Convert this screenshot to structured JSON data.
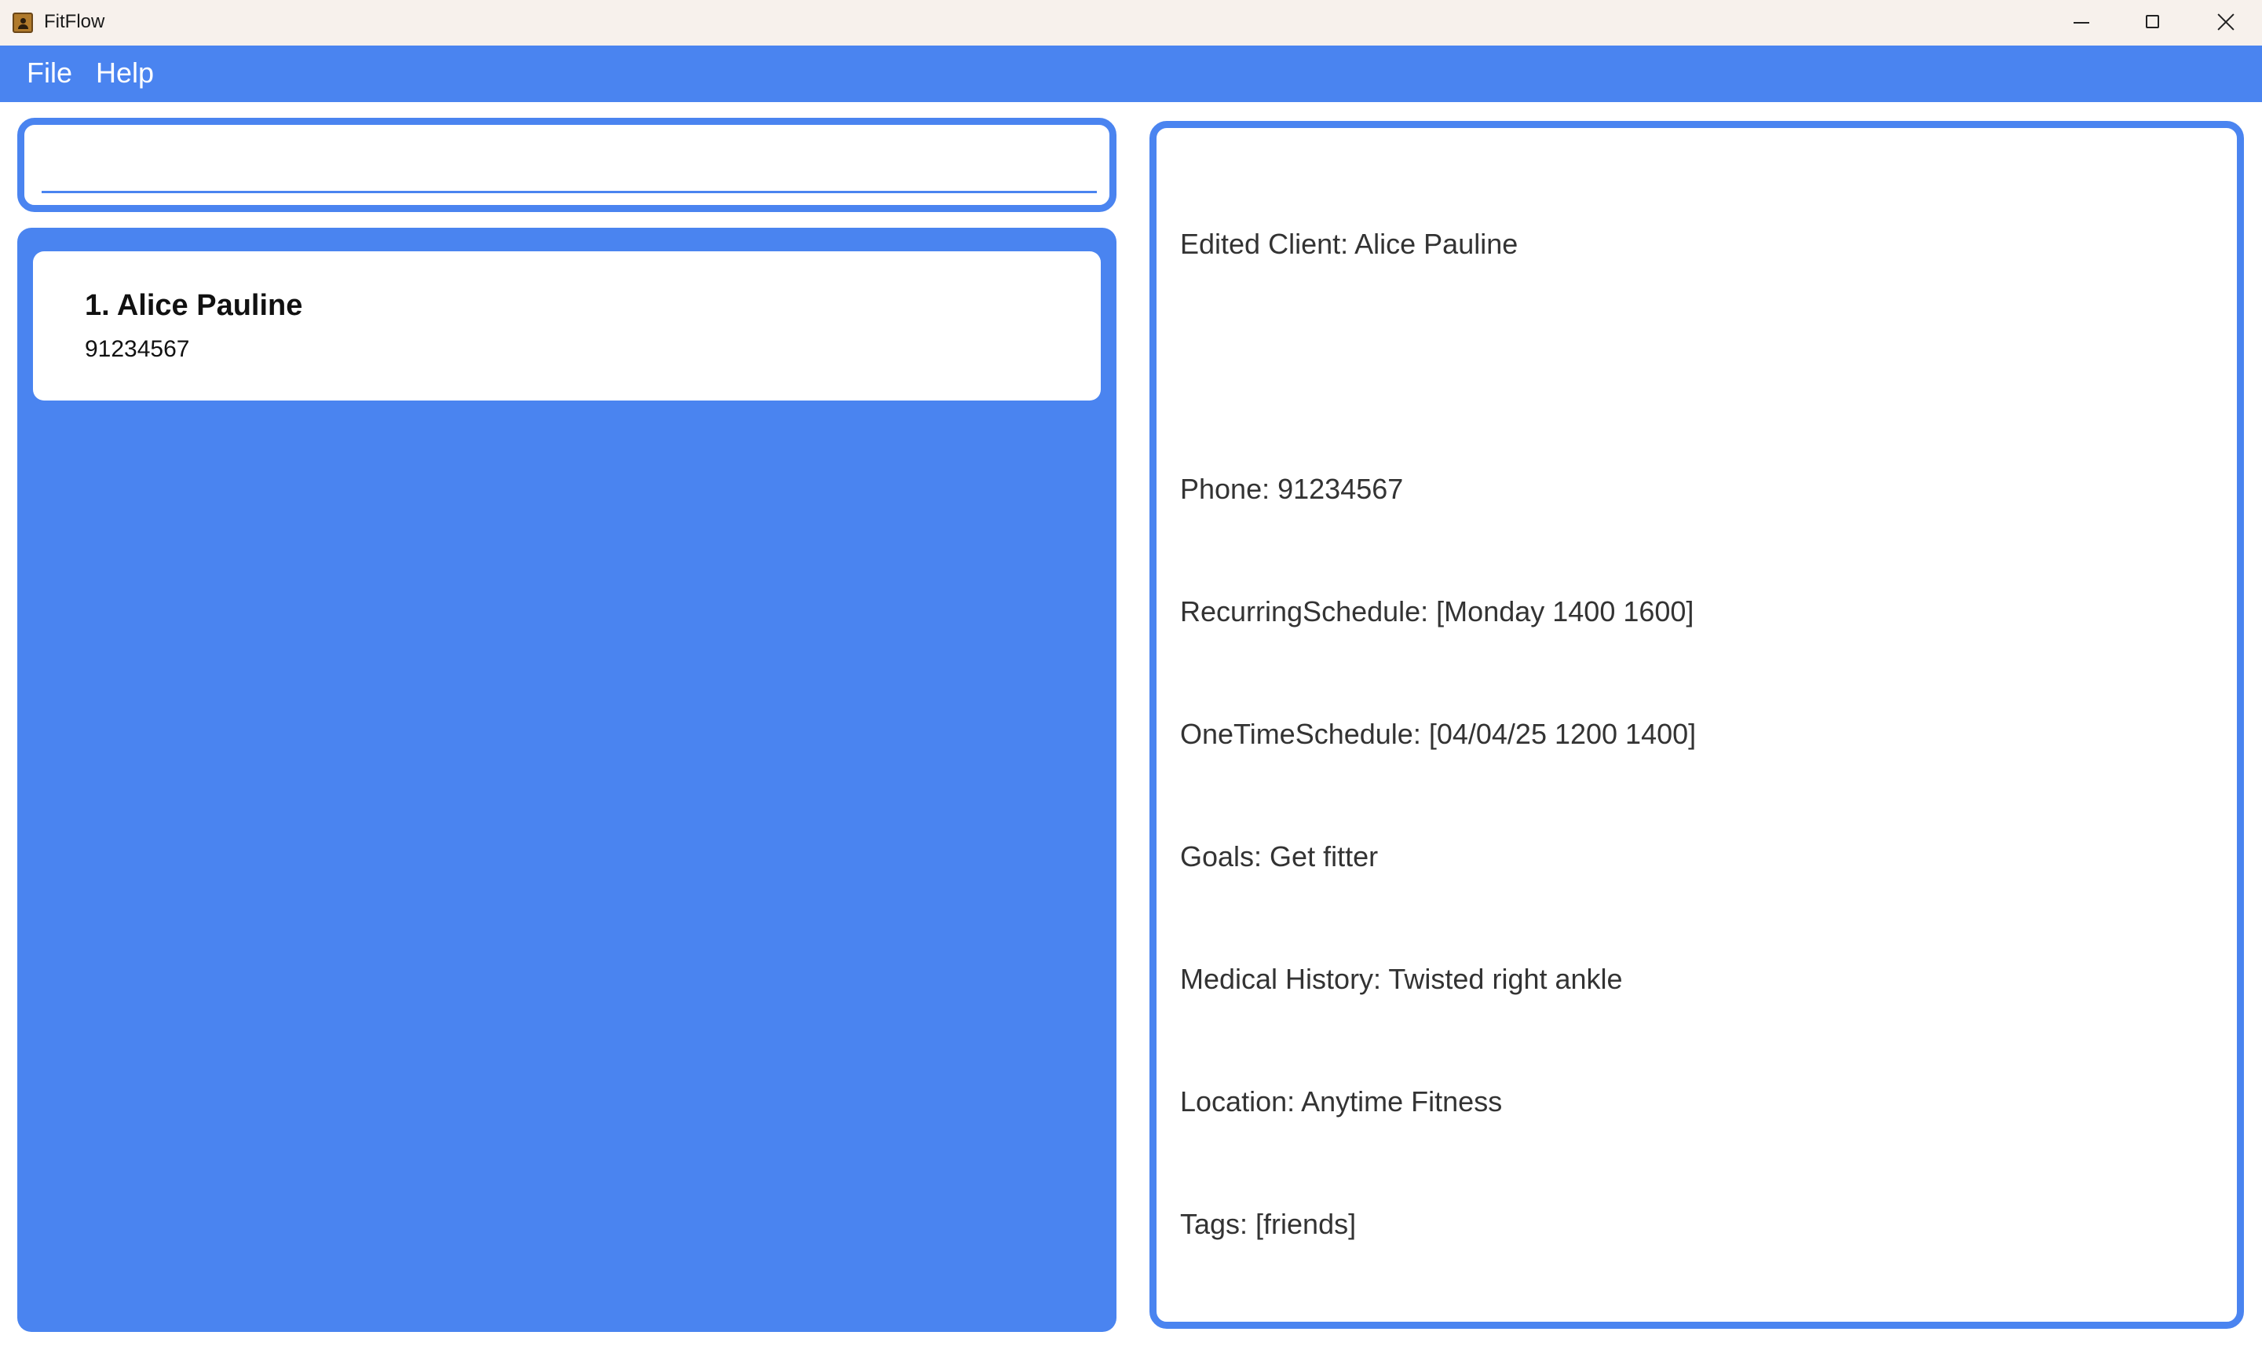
{
  "window": {
    "title": "FitFlow",
    "icon": "contact-card-icon"
  },
  "menu": {
    "file_label": "File",
    "help_label": "Help"
  },
  "command": {
    "value": "",
    "placeholder": ""
  },
  "client_list": {
    "items": [
      {
        "index_name": "1. Alice Pauline",
        "phone": "91234567"
      }
    ]
  },
  "result": {
    "lines": [
      "Edited Client: Alice Pauline",
      "",
      "Phone: 91234567",
      "RecurringSchedule: [Monday 1400 1600]",
      "OneTimeSchedule: [04/04/25 1200 1400]",
      "Goals: Get fitter",
      "Medical History: Twisted right ankle",
      "Location: Anytime Fitness",
      "Tags: [friends]"
    ]
  },
  "colors": {
    "accent": "#4a84f0",
    "titlebar": "#f7f1ec",
    "panel": "#ffffff"
  }
}
